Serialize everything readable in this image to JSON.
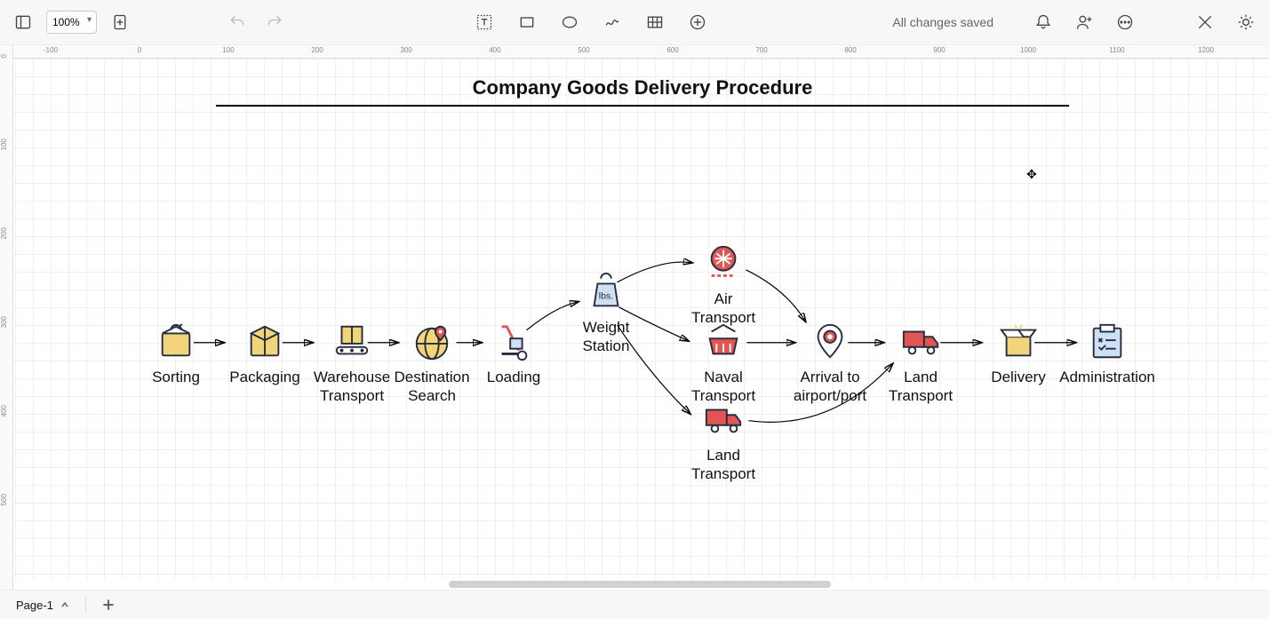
{
  "toolbar": {
    "zoom": "100%",
    "status": "All changes saved"
  },
  "ruler_h": [
    "-100",
    "0",
    "100",
    "200",
    "300",
    "400",
    "500",
    "600",
    "700",
    "800",
    "900",
    "1000",
    "1100",
    "1200"
  ],
  "ruler_v": [
    "0",
    "100",
    "200",
    "300",
    "400",
    "500"
  ],
  "diagram": {
    "title": "Company Goods Delivery Procedure"
  },
  "nodes": {
    "sorting": "Sorting",
    "packaging": "Packaging",
    "warehouse_transport": "Warehouse\nTransport",
    "destination_search": "Destination\nSearch",
    "loading": "Loading",
    "weight_station": "Weight\nStation",
    "air_transport": "Air\nTransport",
    "naval_transport": "Naval\nTransport",
    "land_transport_branch": "Land\nTransport",
    "arrival": "Arrival to\nairport/port",
    "land_transport": "Land\nTransport",
    "delivery": "Delivery",
    "administration": "Administration"
  },
  "tabs": {
    "page1": "Page-1"
  }
}
